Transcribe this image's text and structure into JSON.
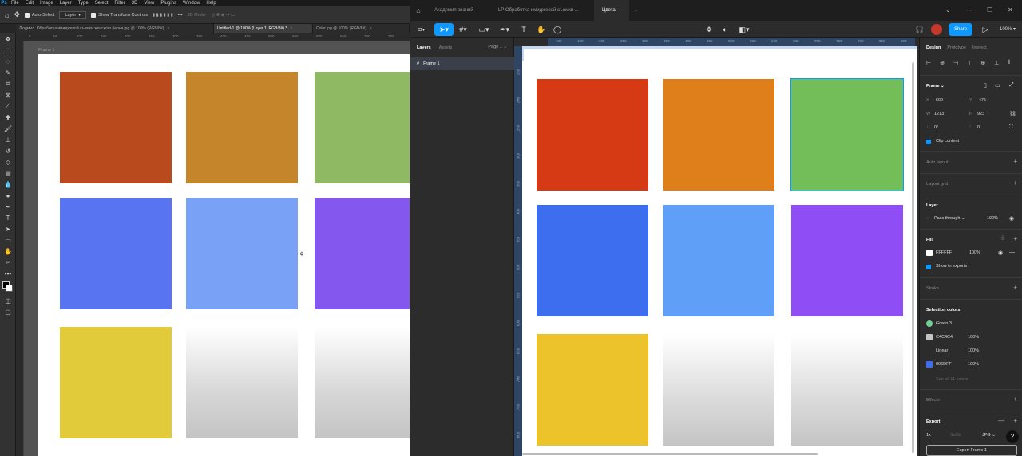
{
  "ps": {
    "menu": [
      "File",
      "Edit",
      "Image",
      "Layer",
      "Type",
      "Select",
      "Filter",
      "3D",
      "View",
      "Plugins",
      "Window",
      "Help"
    ],
    "options": {
      "auto_select": "Auto-Select",
      "layer_select": "Layer",
      "show_transform": "Show Transform Controls",
      "mode_3d": "3D Mode:"
    },
    "tabs": [
      {
        "label": "Людмил. Обработка имиджевой съемки женского белья.jpg @ 100% (RGB/8#)"
      },
      {
        "label": "Untitled-1 @ 100% (Layer 1, RGB/8#) *"
      },
      {
        "label": "Color.jpg @ 100% (RGB/8#)"
      }
    ],
    "ruler_top": [
      "0",
      "50",
      "100",
      "150",
      "200",
      "250",
      "300",
      "350",
      "400",
      "450",
      "500",
      "550",
      "600",
      "650",
      "700",
      "750"
    ],
    "frame_label": "Frame 1",
    "squares": [
      {
        "color": "#b84a1e"
      },
      {
        "color": "#c5852a"
      },
      {
        "color": "#8fb963"
      },
      {
        "color": "#5874f0"
      },
      {
        "color": "#79a1f5"
      },
      {
        "color": "#8458ef"
      },
      {
        "color": "#e2cb3b"
      },
      {
        "color": "gradient"
      },
      {
        "color": "gradient"
      }
    ]
  },
  "fg": {
    "tabs": [
      "Академия знаний",
      "LP Обработка имиджевой съемки ...",
      "Цвета"
    ],
    "share_label": "Share",
    "zoom": "100%",
    "left_tabs": {
      "layers": "Layers",
      "assets": "Assets",
      "page": "Page 1"
    },
    "layer_name": "Frame 1",
    "ruler_top": [
      "100",
      "150",
      "200",
      "250",
      "300",
      "350",
      "400",
      "450",
      "500",
      "550",
      "600",
      "650",
      "700",
      "750",
      "800",
      "850",
      "900"
    ],
    "ruler_left": [
      "150",
      "200",
      "250",
      "300",
      "350",
      "400",
      "450",
      "500",
      "550",
      "600",
      "650",
      "700",
      "750",
      "800"
    ],
    "squares": [
      {
        "color": "#d63a14"
      },
      {
        "color": "#df7f1c"
      },
      {
        "color": "#74be5a"
      },
      {
        "color": "#3d6ef0"
      },
      {
        "color": "#609ff8"
      },
      {
        "color": "#8f4df5"
      },
      {
        "color": "#ecc32b"
      },
      {
        "color": "gradient"
      },
      {
        "color": "gradient"
      }
    ],
    "right": {
      "tabs": {
        "design": "Design",
        "prototype": "Prototype",
        "inspect": "Inspect"
      },
      "frame": {
        "title": "Frame",
        "x_lbl": "X",
        "x": "-609",
        "y_lbl": "Y",
        "y": "-475",
        "w_lbl": "W",
        "w": "1213",
        "h_lbl": "H",
        "h": "923",
        "rot": "0°",
        "radius": "0",
        "clip": "Clip content"
      },
      "auto_layout": "Auto layout",
      "layout_grid": "Layout grid",
      "layer": {
        "title": "Layer",
        "blend": "Pass through",
        "opacity": "100%"
      },
      "fill": {
        "title": "Fill",
        "hex": "FFFFFF",
        "opacity": "100%",
        "show_exports": "Show in exports"
      },
      "stroke": "Stroke",
      "selection_colors": {
        "title": "Selection colors",
        "items": [
          {
            "name": "Green 3",
            "opacity": "",
            "color": "#6fcf97"
          },
          {
            "name": "C4C4C4",
            "opacity": "100%",
            "color": "#c4c4c4"
          },
          {
            "name": "Linear",
            "opacity": "100%",
            "color": "#2c2c2c"
          },
          {
            "name": "006DFF",
            "opacity": "100%",
            "color": "#3d6ef0"
          }
        ],
        "see_all": "See all 11 colors"
      },
      "effects": "Effects",
      "export": {
        "title": "Export",
        "scale": "1x",
        "suffix": "Suffix",
        "format": "JPG",
        "button": "Export Frame 1"
      },
      "help": "?"
    }
  }
}
